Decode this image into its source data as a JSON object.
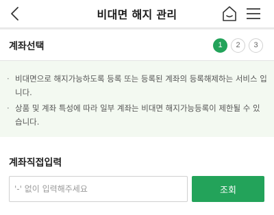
{
  "header": {
    "title": "비대면 해지 관리",
    "back_icon": "chevron-left-icon",
    "home_icon": "home-icon",
    "menu_icon": "hamburger-menu-icon"
  },
  "steps": {
    "label": "계좌선택",
    "items": [
      "1",
      "2",
      "3"
    ],
    "active_index": 0,
    "accent_color": "#23a35a"
  },
  "notice": {
    "bullet": "·",
    "items": [
      "비대면으로 해지가능하도록 등록 또는 등록된 계좌의 등록해제하는 서비스 입니다.",
      "상품 및 계좌 특성에 따라 일부 계좌는 비대면 해지가능등록이 제한될 수 있습니다."
    ]
  },
  "account_input": {
    "section_title": "계좌직접입력",
    "placeholder": "'-' 없이 입력해주세요",
    "value": "",
    "submit_label": "조회"
  }
}
